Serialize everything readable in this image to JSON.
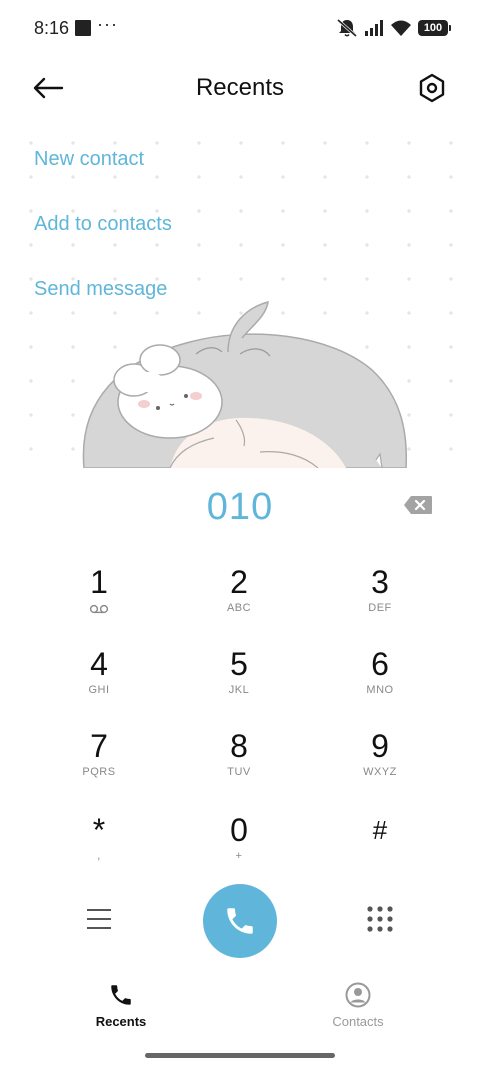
{
  "status_bar": {
    "time": "8:16",
    "overflow": "···",
    "battery": "100",
    "icons": [
      "notification-square-icon",
      "mute-icon",
      "signal-icon",
      "wifi-icon",
      "battery-icon"
    ]
  },
  "header": {
    "title": "Recents",
    "back_icon": "arrow-left-icon",
    "settings_icon": "hexagon-settings-icon"
  },
  "actions": {
    "new_contact": "New contact",
    "add_to_contacts": "Add to contacts",
    "send_message": "Send message"
  },
  "dialer": {
    "number": "010",
    "backspace_icon": "backspace-icon"
  },
  "keypad": [
    {
      "digit": "1",
      "letters": "",
      "icon": "voicemail-icon"
    },
    {
      "digit": "2",
      "letters": "ABC"
    },
    {
      "digit": "3",
      "letters": "DEF"
    },
    {
      "digit": "4",
      "letters": "GHI"
    },
    {
      "digit": "5",
      "letters": "JKL"
    },
    {
      "digit": "6",
      "letters": "MNO"
    },
    {
      "digit": "7",
      "letters": "PQRS"
    },
    {
      "digit": "8",
      "letters": "TUV"
    },
    {
      "digit": "9",
      "letters": "WXYZ"
    },
    {
      "digit": "*",
      "letters": ","
    },
    {
      "digit": "0",
      "letters": "+"
    },
    {
      "digit": "#",
      "letters": ""
    }
  ],
  "bottom_actions": {
    "menu_icon": "hamburger-menu-icon",
    "call_icon": "phone-icon",
    "keypad_icon": "dialpad-grid-icon"
  },
  "nav": {
    "recents": "Recents",
    "contacts": "Contacts"
  },
  "colors": {
    "accent": "#5fb6da",
    "text": "#111111",
    "muted": "#888888"
  }
}
